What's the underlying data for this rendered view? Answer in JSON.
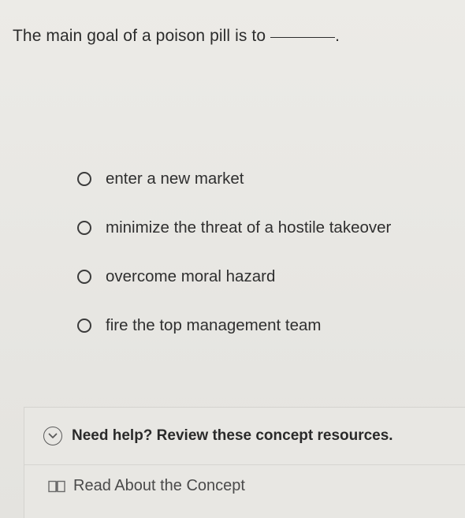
{
  "question": {
    "text": "The main goal of a poison pill is to",
    "trailing_punct": "."
  },
  "options": [
    {
      "label": "enter a new market",
      "selected": false
    },
    {
      "label": "minimize the threat of a hostile takeover",
      "selected": false
    },
    {
      "label": "overcome moral hazard",
      "selected": false
    },
    {
      "label": "fire the top management team",
      "selected": false
    }
  ],
  "help": {
    "header_text": "Need help? Review these concept resources.",
    "icon": "chevron-down-circle-icon",
    "link_icon": "book-icon",
    "link_text": "Read About the Concept"
  }
}
